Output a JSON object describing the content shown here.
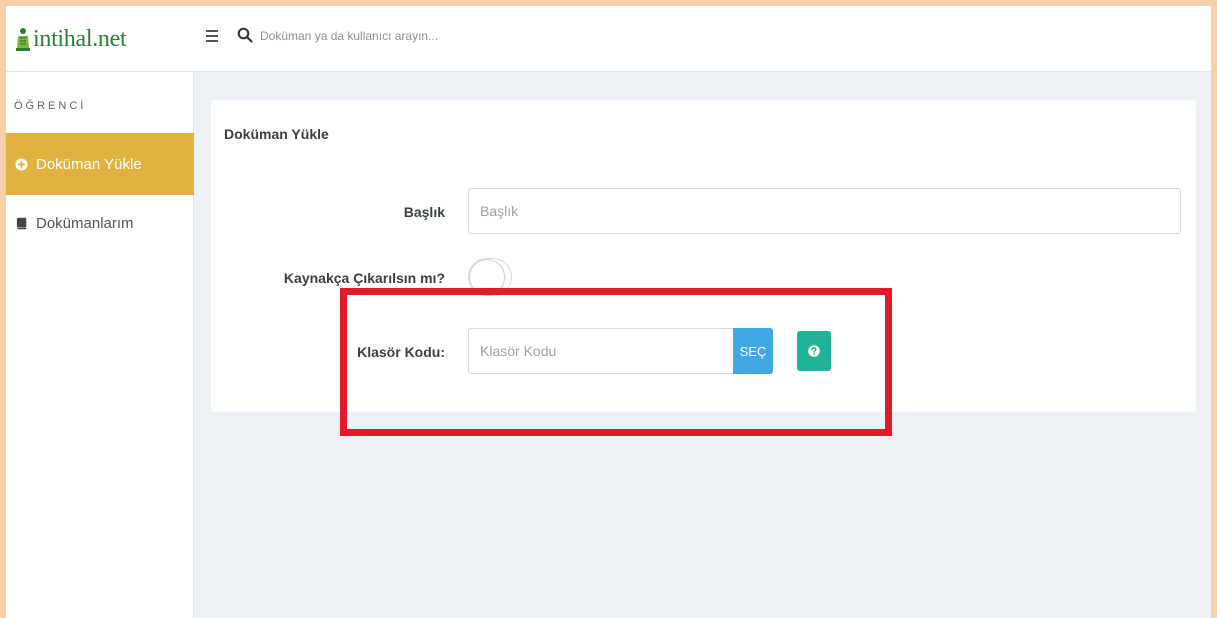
{
  "app": {
    "logo_text": "intihal.net",
    "brand_color": "#2e7d32"
  },
  "topbar": {
    "menu_icon": "hamburger-icon",
    "search_icon": "search-icon",
    "search_placeholder": "Doküman ya da kullanıcı arayın..."
  },
  "sidebar": {
    "section_header": "ÖĞRENCİ",
    "items": [
      {
        "label": "Doküman Yükle",
        "icon": "plus-circle-icon",
        "active": true
      },
      {
        "label": "Dokümanlarım",
        "icon": "book-icon",
        "active": false
      }
    ],
    "active_color": "#e0b23f"
  },
  "form": {
    "title": "Doküman Yükle",
    "baslik_label": "Başlık",
    "baslik_placeholder": "Başlık",
    "kaynakca_label": "Kaynakça Çıkarılsın mı?",
    "kaynakca_enabled": false,
    "klasor_label": "Klasör Kodu:",
    "klasor_placeholder": "Klasör Kodu",
    "sec_button": "SEÇ",
    "sec_color": "#3fa7e1",
    "help_icon": "question-circle-icon",
    "help_color": "#20b39a"
  },
  "annotation": {
    "highlight_color": "#e21b2a"
  }
}
